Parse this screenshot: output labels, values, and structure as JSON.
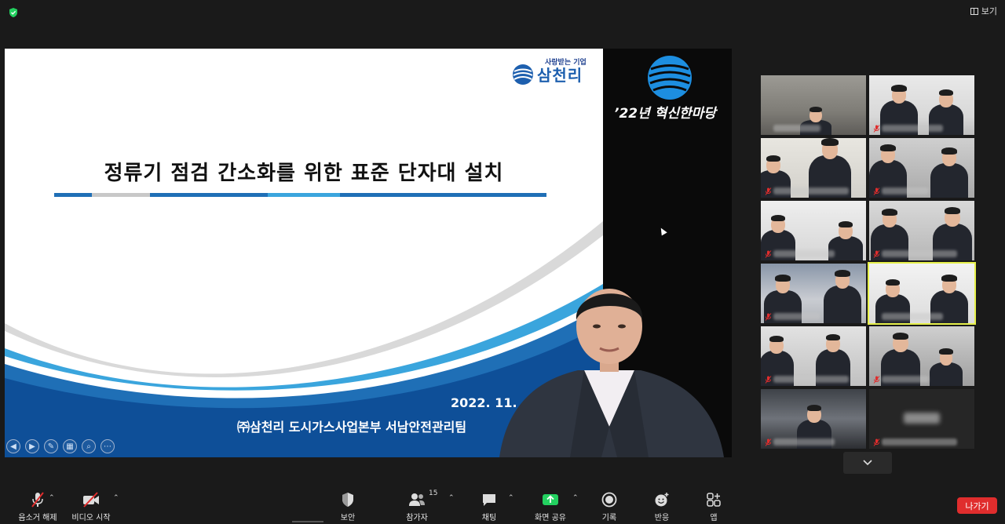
{
  "topbar": {
    "view_label": "보기"
  },
  "slide": {
    "slogan": "사랑받는 기업",
    "brand": "삼천리",
    "title": "정류기 점검 간소화를 위한 표준 단자대 설치",
    "date": "2022. 11.",
    "organization": "㈜삼천리 도시가스사업본부 서남안전관리팀"
  },
  "event": {
    "title": "’22년 혁신한마당"
  },
  "gallery": {
    "tiles": [
      {
        "muted": false,
        "active": false
      },
      {
        "muted": true,
        "active": false
      },
      {
        "muted": true,
        "active": false
      },
      {
        "muted": true,
        "active": false
      },
      {
        "muted": true,
        "active": false
      },
      {
        "muted": true,
        "active": false
      },
      {
        "muted": true,
        "active": false
      },
      {
        "muted": false,
        "active": true
      },
      {
        "muted": true,
        "active": false
      },
      {
        "muted": true,
        "active": false
      },
      {
        "muted": true,
        "active": false
      },
      {
        "muted": true,
        "active": false
      }
    ]
  },
  "toolbar": {
    "unmute_label": "음소거 해제",
    "video_label": "비디오 시작",
    "security_label": "보안",
    "participants_label": "참가자",
    "participants_count": "15",
    "chat_label": "채팅",
    "share_label": "화면 공유",
    "record_label": "기록",
    "reactions_label": "반응",
    "apps_label": "앱",
    "leave_label": "나가기"
  },
  "colors": {
    "accent_green": "#23d160",
    "leave_red": "#e02d2d",
    "active_speaker": "#e6f04a",
    "brand_blue": "#1d5fae"
  }
}
